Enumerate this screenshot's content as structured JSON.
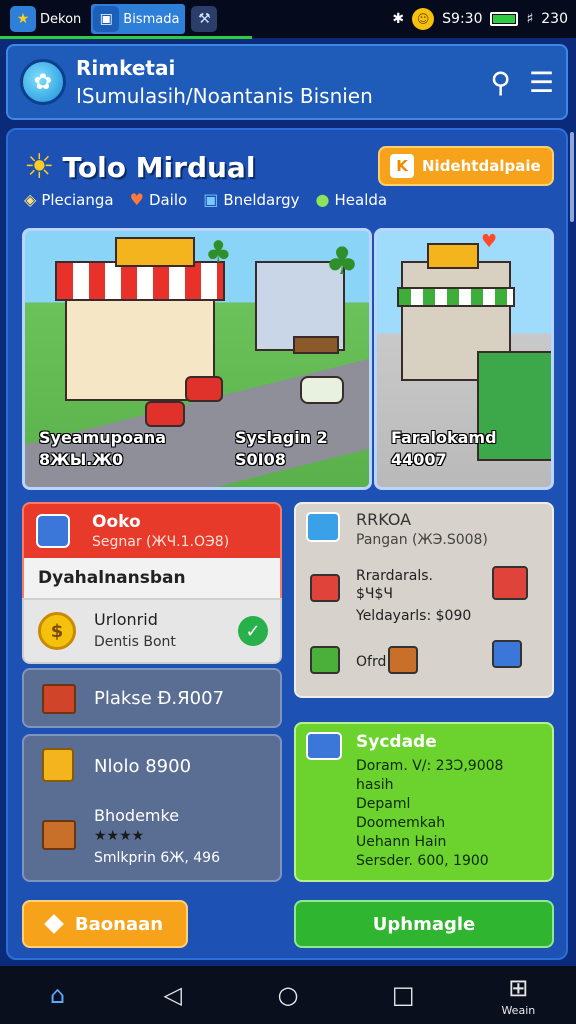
{
  "status_bar": {
    "apps": [
      {
        "label": "Dekon"
      },
      {
        "label": "Bismada"
      }
    ],
    "time": "S9:30",
    "battery": "230"
  },
  "header": {
    "title": "Rimketai",
    "subtitle": "ISumulasih/Noantanis Bisnien"
  },
  "main": {
    "title": "Tolo Mirdual",
    "top_button": "Nidehtdalpaie",
    "legend": [
      "Plecianga",
      "Dailo",
      "Bneldargy",
      "Healda"
    ],
    "scenes": [
      {
        "name": "Syeamupoana",
        "value": "8ЖЫ.Ж0"
      },
      {
        "name": "Syslagin 2",
        "value": "S0I08"
      },
      {
        "name": "Faralokamd",
        "value": "44007"
      }
    ],
    "card_red": {
      "title": "Ooko",
      "subtitle": "Segnar (ЖЧ.1.ОЭ8)"
    },
    "card_list_header": "Dyahalnansban",
    "card_coin": {
      "title": "Urlonrid",
      "subtitle": "Dentis Bont"
    },
    "slate_1": {
      "label": "Plakse Ð.Я007"
    },
    "slate_2": {
      "label": "Nlolo 8900",
      "item_name": "Bhodemke",
      "stars": "★★★★",
      "price": "Smlkprin 6Ж, 496"
    },
    "card_grey": {
      "title": "RRKOA",
      "subtitle": "Pangan (ЖЭ.S008)",
      "line1": "Rrardarals.",
      "line2": "$Ч$Ч",
      "line3": "Yeldayarls: $090",
      "line4": "Ofrd"
    },
    "card_green": {
      "title": "Sycdade",
      "lines": [
        "Doram. V/: 23Ɔ,9008",
        "hasih",
        "Depaml",
        "Doomemkah",
        "Uehann Hain",
        "Sersder. 600, 1900"
      ]
    },
    "btn_left": "Baonaan",
    "btn_right": "Uphmagle"
  },
  "nav": {
    "extra_label": "Weain"
  }
}
